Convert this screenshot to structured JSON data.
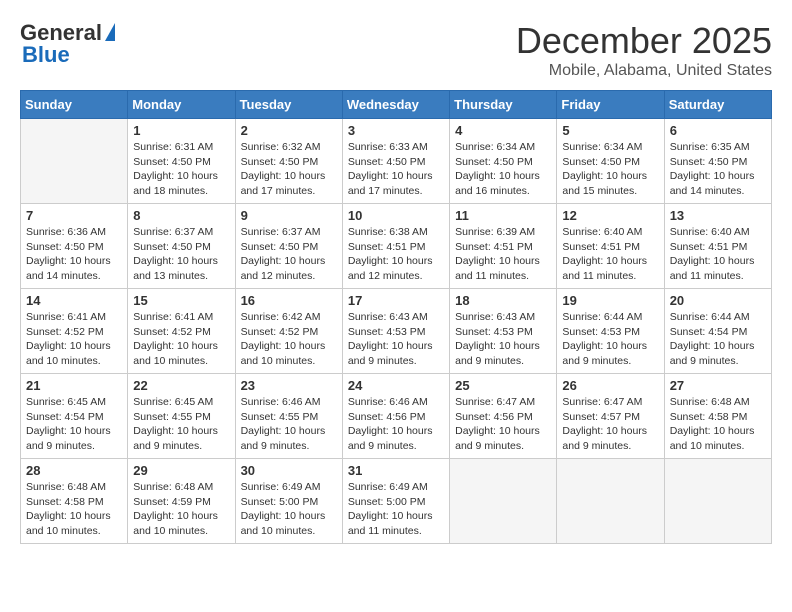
{
  "header": {
    "logo_general": "General",
    "logo_blue": "Blue",
    "month_title": "December 2025",
    "location": "Mobile, Alabama, United States"
  },
  "days_of_week": [
    "Sunday",
    "Monday",
    "Tuesday",
    "Wednesday",
    "Thursday",
    "Friday",
    "Saturday"
  ],
  "weeks": [
    [
      {
        "day": "",
        "info": ""
      },
      {
        "day": "1",
        "info": "Sunrise: 6:31 AM\nSunset: 4:50 PM\nDaylight: 10 hours\nand 18 minutes."
      },
      {
        "day": "2",
        "info": "Sunrise: 6:32 AM\nSunset: 4:50 PM\nDaylight: 10 hours\nand 17 minutes."
      },
      {
        "day": "3",
        "info": "Sunrise: 6:33 AM\nSunset: 4:50 PM\nDaylight: 10 hours\nand 17 minutes."
      },
      {
        "day": "4",
        "info": "Sunrise: 6:34 AM\nSunset: 4:50 PM\nDaylight: 10 hours\nand 16 minutes."
      },
      {
        "day": "5",
        "info": "Sunrise: 6:34 AM\nSunset: 4:50 PM\nDaylight: 10 hours\nand 15 minutes."
      },
      {
        "day": "6",
        "info": "Sunrise: 6:35 AM\nSunset: 4:50 PM\nDaylight: 10 hours\nand 14 minutes."
      }
    ],
    [
      {
        "day": "7",
        "info": "Sunrise: 6:36 AM\nSunset: 4:50 PM\nDaylight: 10 hours\nand 14 minutes."
      },
      {
        "day": "8",
        "info": "Sunrise: 6:37 AM\nSunset: 4:50 PM\nDaylight: 10 hours\nand 13 minutes."
      },
      {
        "day": "9",
        "info": "Sunrise: 6:37 AM\nSunset: 4:50 PM\nDaylight: 10 hours\nand 12 minutes."
      },
      {
        "day": "10",
        "info": "Sunrise: 6:38 AM\nSunset: 4:51 PM\nDaylight: 10 hours\nand 12 minutes."
      },
      {
        "day": "11",
        "info": "Sunrise: 6:39 AM\nSunset: 4:51 PM\nDaylight: 10 hours\nand 11 minutes."
      },
      {
        "day": "12",
        "info": "Sunrise: 6:40 AM\nSunset: 4:51 PM\nDaylight: 10 hours\nand 11 minutes."
      },
      {
        "day": "13",
        "info": "Sunrise: 6:40 AM\nSunset: 4:51 PM\nDaylight: 10 hours\nand 11 minutes."
      }
    ],
    [
      {
        "day": "14",
        "info": "Sunrise: 6:41 AM\nSunset: 4:52 PM\nDaylight: 10 hours\nand 10 minutes."
      },
      {
        "day": "15",
        "info": "Sunrise: 6:41 AM\nSunset: 4:52 PM\nDaylight: 10 hours\nand 10 minutes."
      },
      {
        "day": "16",
        "info": "Sunrise: 6:42 AM\nSunset: 4:52 PM\nDaylight: 10 hours\nand 10 minutes."
      },
      {
        "day": "17",
        "info": "Sunrise: 6:43 AM\nSunset: 4:53 PM\nDaylight: 10 hours\nand 9 minutes."
      },
      {
        "day": "18",
        "info": "Sunrise: 6:43 AM\nSunset: 4:53 PM\nDaylight: 10 hours\nand 9 minutes."
      },
      {
        "day": "19",
        "info": "Sunrise: 6:44 AM\nSunset: 4:53 PM\nDaylight: 10 hours\nand 9 minutes."
      },
      {
        "day": "20",
        "info": "Sunrise: 6:44 AM\nSunset: 4:54 PM\nDaylight: 10 hours\nand 9 minutes."
      }
    ],
    [
      {
        "day": "21",
        "info": "Sunrise: 6:45 AM\nSunset: 4:54 PM\nDaylight: 10 hours\nand 9 minutes."
      },
      {
        "day": "22",
        "info": "Sunrise: 6:45 AM\nSunset: 4:55 PM\nDaylight: 10 hours\nand 9 minutes."
      },
      {
        "day": "23",
        "info": "Sunrise: 6:46 AM\nSunset: 4:55 PM\nDaylight: 10 hours\nand 9 minutes."
      },
      {
        "day": "24",
        "info": "Sunrise: 6:46 AM\nSunset: 4:56 PM\nDaylight: 10 hours\nand 9 minutes."
      },
      {
        "day": "25",
        "info": "Sunrise: 6:47 AM\nSunset: 4:56 PM\nDaylight: 10 hours\nand 9 minutes."
      },
      {
        "day": "26",
        "info": "Sunrise: 6:47 AM\nSunset: 4:57 PM\nDaylight: 10 hours\nand 9 minutes."
      },
      {
        "day": "27",
        "info": "Sunrise: 6:48 AM\nSunset: 4:58 PM\nDaylight: 10 hours\nand 10 minutes."
      }
    ],
    [
      {
        "day": "28",
        "info": "Sunrise: 6:48 AM\nSunset: 4:58 PM\nDaylight: 10 hours\nand 10 minutes."
      },
      {
        "day": "29",
        "info": "Sunrise: 6:48 AM\nSunset: 4:59 PM\nDaylight: 10 hours\nand 10 minutes."
      },
      {
        "day": "30",
        "info": "Sunrise: 6:49 AM\nSunset: 5:00 PM\nDaylight: 10 hours\nand 10 minutes."
      },
      {
        "day": "31",
        "info": "Sunrise: 6:49 AM\nSunset: 5:00 PM\nDaylight: 10 hours\nand 11 minutes."
      },
      {
        "day": "",
        "info": ""
      },
      {
        "day": "",
        "info": ""
      },
      {
        "day": "",
        "info": ""
      }
    ]
  ]
}
